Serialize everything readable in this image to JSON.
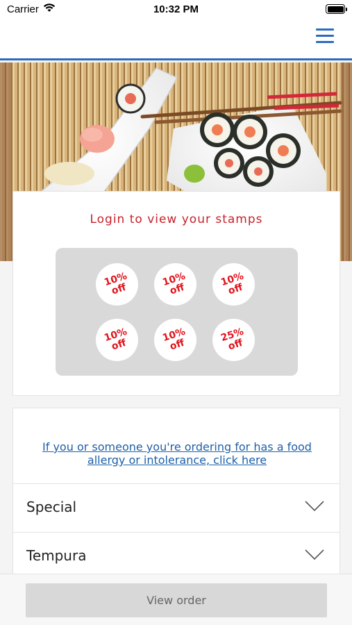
{
  "status_bar": {
    "carrier": "Carrier",
    "time": "10:32 PM"
  },
  "nav": {
    "menu_icon": "hamburger-menu-icon",
    "accent_color": "#2a6bbf"
  },
  "stamp_card": {
    "title": "Login to view your stamps",
    "title_color": "#c8202a",
    "stamps": [
      {
        "text": "10%\noff"
      },
      {
        "text": "10%\noff"
      },
      {
        "text": "10%\noff"
      },
      {
        "text": "10%\noff"
      },
      {
        "text": "10%\noff"
      },
      {
        "text": "25%\noff"
      }
    ]
  },
  "allergy": {
    "link_text": "If you or someone you're ordering for has a food allergy or intolerance, click here",
    "link_color": "#1d5fa8"
  },
  "menu_categories": [
    {
      "label": "Special",
      "icon": "chevron-down-icon"
    },
    {
      "label": "Tempura",
      "icon": "chevron-down-icon"
    }
  ],
  "bottom_bar": {
    "view_order_label": "View order"
  }
}
